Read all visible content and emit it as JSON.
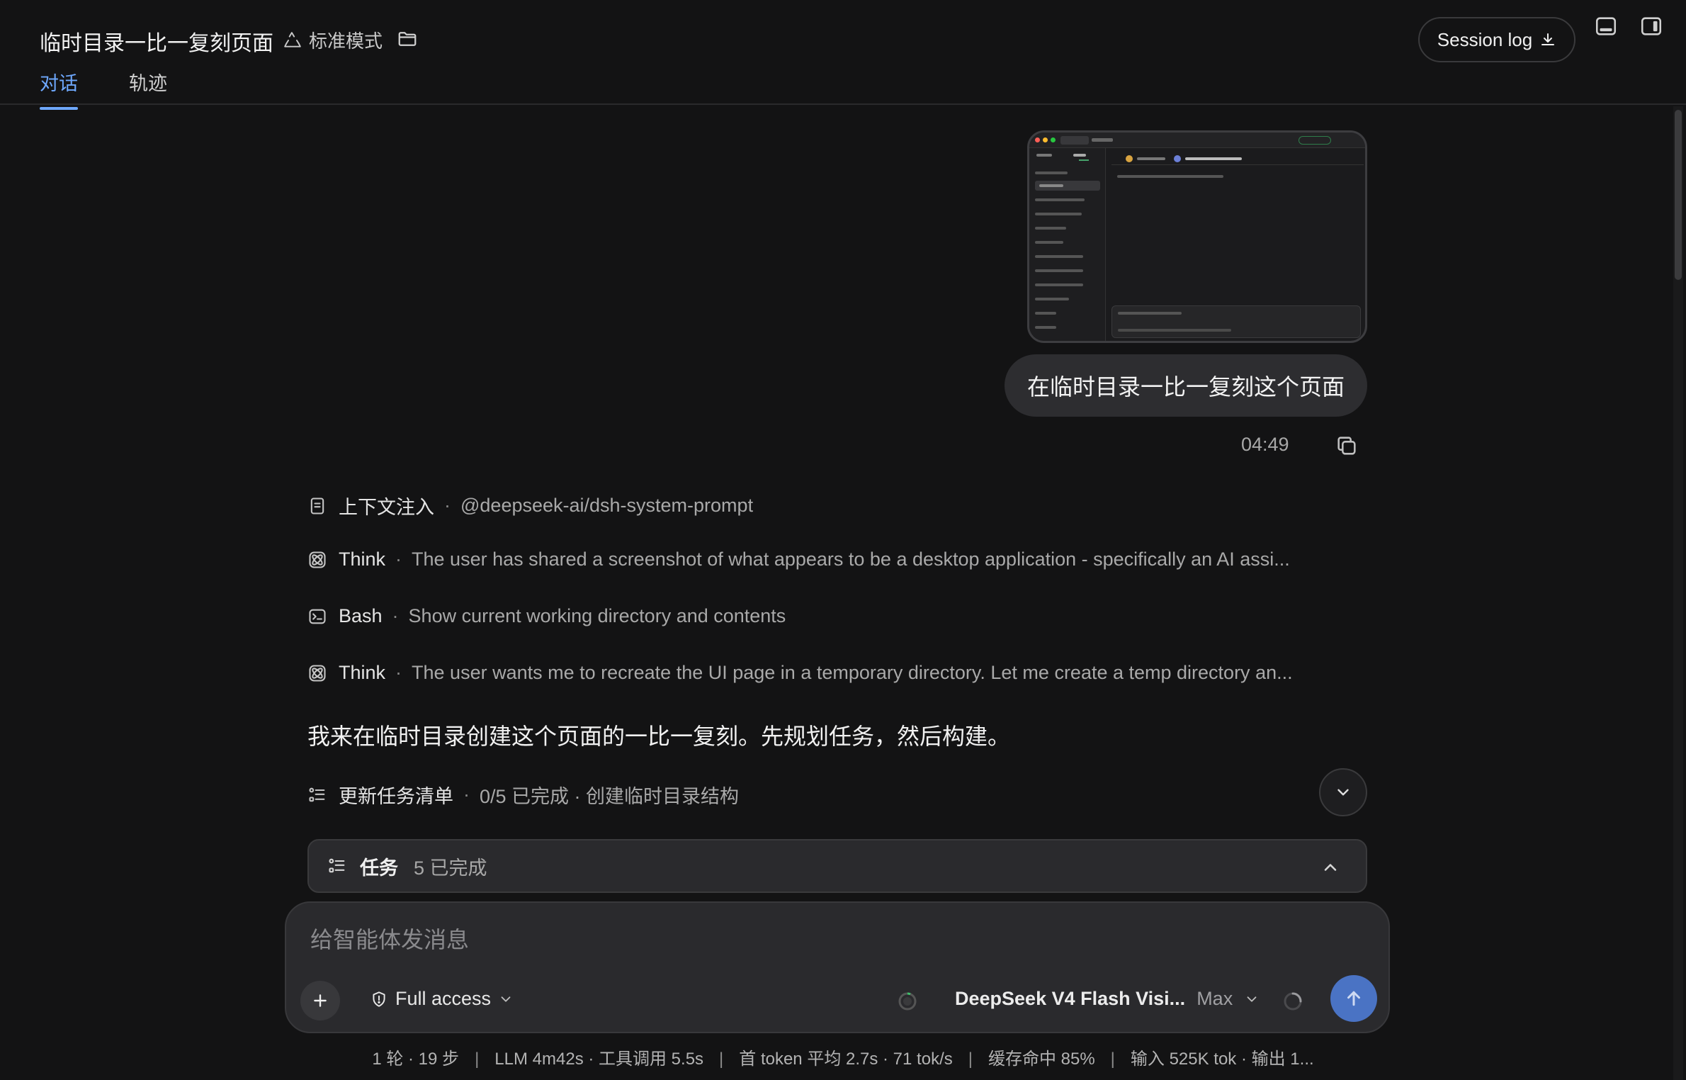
{
  "header": {
    "title": "临时目录一比一复刻页面",
    "mode_label": "标准模式",
    "session_log_label": "Session log"
  },
  "tabs": [
    {
      "label": "对话",
      "active": true
    },
    {
      "label": "轨迹",
      "active": false
    }
  ],
  "user_message": {
    "text": "在临时目录一比一复刻这个页面",
    "time": "04:49"
  },
  "steps": [
    {
      "icon": "document-icon",
      "label": "上下文注入",
      "desc": "@deepseek-ai/dsh-system-prompt"
    },
    {
      "icon": "think-icon",
      "label": "Think",
      "desc": "The user has shared a screenshot of what appears to be a desktop application - specifically an AI assi..."
    },
    {
      "icon": "terminal-icon",
      "label": "Bash",
      "desc": "Show current working directory and contents"
    },
    {
      "icon": "think-icon",
      "label": "Think",
      "desc": "The user wants me to recreate the UI page in a temporary directory. Let me create a temp directory an..."
    }
  ],
  "assistant_text": "我来在临时目录创建这个页面的一比一复刻。先规划任务，然后构建。",
  "task_update": {
    "label": "更新任务清单",
    "desc": "0/5 已完成 · 创建临时目录结构"
  },
  "task_panel": {
    "title": "任务",
    "count": "5 已完成"
  },
  "composer": {
    "placeholder": "给智能体发消息",
    "access_label": "Full access",
    "model_name": "DeepSeek V4 Flash Visi...",
    "effort": "Max"
  },
  "footer": {
    "items": [
      "1 轮 · 19 步",
      "LLM 4m42s · 工具调用 5.5s",
      "首 token 平均 2.7s · 71 tok/s",
      "缓存命中 85%",
      "输入 525K tok · 输出 1..."
    ]
  },
  "colors": {
    "background": "#131314",
    "accent": "#6ea8fe",
    "send_button": "#4a73c4",
    "bubble": "#2d2d30"
  }
}
